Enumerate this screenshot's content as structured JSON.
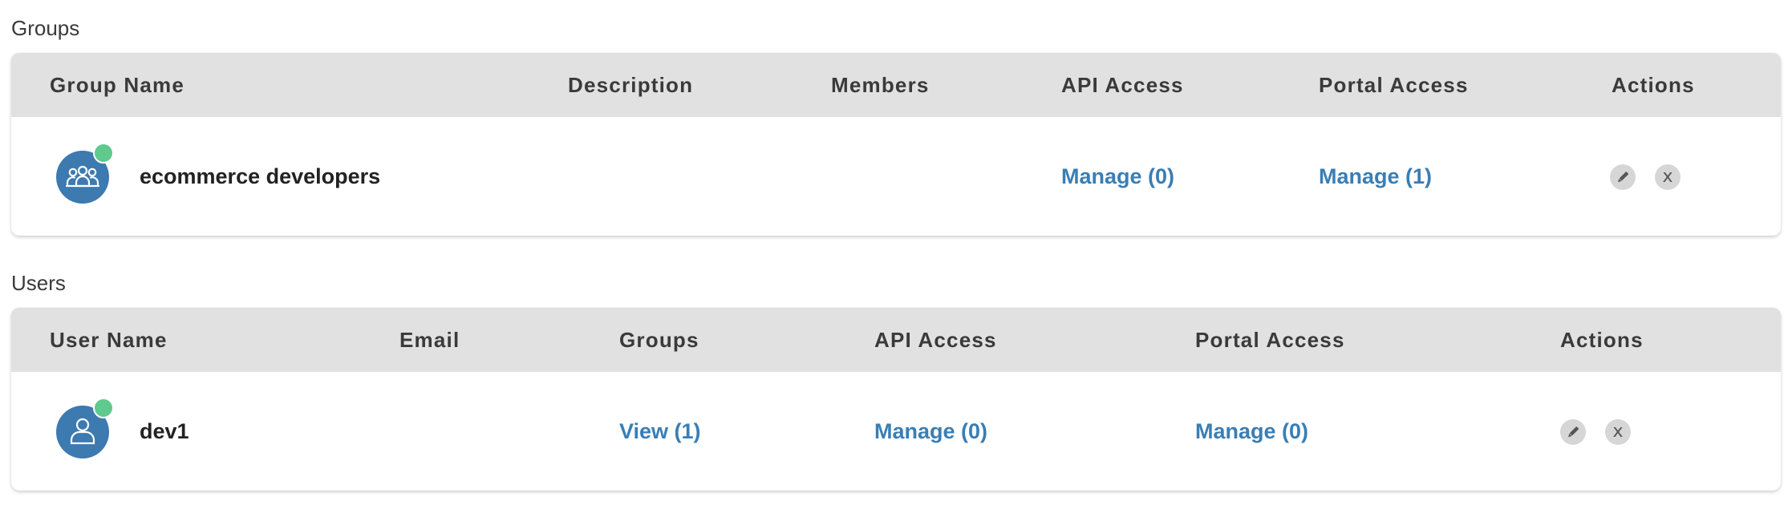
{
  "groups": {
    "section_title": "Groups",
    "columns": {
      "name": "Group Name",
      "description": "Description",
      "members": "Members",
      "api_access": "API Access",
      "portal_access": "Portal Access",
      "actions": "Actions"
    },
    "rows": [
      {
        "name": "ecommerce developers",
        "description": "",
        "members": "",
        "api_access": "Manage (0)",
        "portal_access": "Manage (1)",
        "avatar_icon": "group-icon",
        "status": "active"
      }
    ]
  },
  "users": {
    "section_title": "Users",
    "columns": {
      "name": "User Name",
      "email": "Email",
      "groups": "Groups",
      "api_access": "API Access",
      "portal_access": "Portal Access",
      "actions": "Actions"
    },
    "rows": [
      {
        "name": "dev1",
        "email": "",
        "groups": "View (1)",
        "api_access": "Manage (0)",
        "portal_access": "Manage (0)",
        "avatar_icon": "user-icon",
        "status": "active"
      }
    ]
  },
  "actions": {
    "edit_icon": "pencil-icon",
    "delete_glyph": "x"
  },
  "colors": {
    "header_bg": "#e1e1e1",
    "link": "#3a7eb4",
    "avatar": "#3c7ab0",
    "status_active": "#5fc98e",
    "action_btn_bg": "#d6d6d6"
  }
}
